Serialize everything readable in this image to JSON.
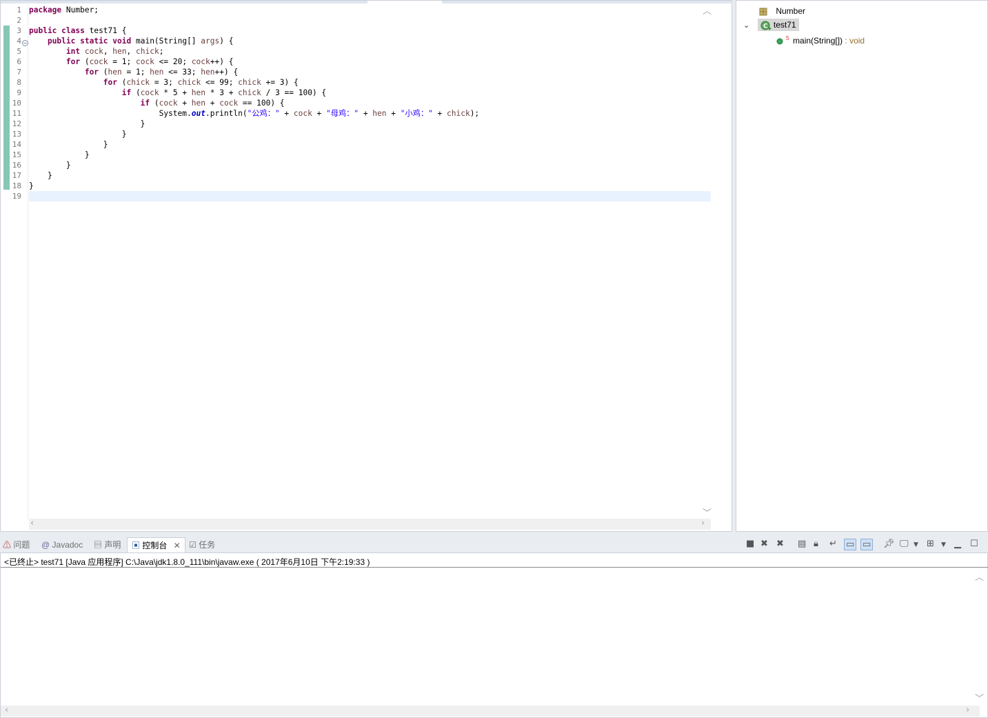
{
  "editor": {
    "lines": [
      {
        "num": "1",
        "html_parts": [
          [
            "kw",
            "package"
          ],
          [
            "p",
            " Number;"
          ]
        ]
      },
      {
        "num": "2",
        "html_parts": []
      },
      {
        "num": "3",
        "html_parts": [
          [
            "kw",
            "public"
          ],
          [
            "p",
            " "
          ],
          [
            "kw",
            "class"
          ],
          [
            "p",
            " test71 {"
          ]
        ]
      },
      {
        "num": "4",
        "html_parts": [
          [
            "p",
            "    "
          ],
          [
            "kw",
            "public"
          ],
          [
            "p",
            " "
          ],
          [
            "kw",
            "static"
          ],
          [
            "p",
            " "
          ],
          [
            "kw",
            "void"
          ],
          [
            "p",
            " main(String[] "
          ],
          [
            "var",
            "args"
          ],
          [
            "p",
            ") {"
          ]
        ]
      },
      {
        "num": "5",
        "html_parts": [
          [
            "p",
            "        "
          ],
          [
            "kw",
            "int"
          ],
          [
            "p",
            " "
          ],
          [
            "var",
            "cock"
          ],
          [
            "p",
            ", "
          ],
          [
            "var",
            "hen"
          ],
          [
            "p",
            ", "
          ],
          [
            "var",
            "chick"
          ],
          [
            "p",
            ";"
          ]
        ]
      },
      {
        "num": "6",
        "html_parts": [
          [
            "p",
            "        "
          ],
          [
            "kw",
            "for"
          ],
          [
            "p",
            " ("
          ],
          [
            "var",
            "cock"
          ],
          [
            "p",
            " = 1; "
          ],
          [
            "var",
            "cock"
          ],
          [
            "p",
            " <= 20; "
          ],
          [
            "var",
            "cock"
          ],
          [
            "p",
            "++) {"
          ]
        ]
      },
      {
        "num": "7",
        "html_parts": [
          [
            "p",
            "            "
          ],
          [
            "kw",
            "for"
          ],
          [
            "p",
            " ("
          ],
          [
            "var",
            "hen"
          ],
          [
            "p",
            " = 1; "
          ],
          [
            "var",
            "hen"
          ],
          [
            "p",
            " <= 33; "
          ],
          [
            "var",
            "hen"
          ],
          [
            "p",
            "++) {"
          ]
        ]
      },
      {
        "num": "8",
        "html_parts": [
          [
            "p",
            "                "
          ],
          [
            "kw",
            "for"
          ],
          [
            "p",
            " ("
          ],
          [
            "var",
            "chick"
          ],
          [
            "p",
            " = 3; "
          ],
          [
            "var",
            "chick"
          ],
          [
            "p",
            " <= 99; "
          ],
          [
            "var",
            "chick"
          ],
          [
            "p",
            " += 3) {"
          ]
        ]
      },
      {
        "num": "9",
        "html_parts": [
          [
            "p",
            "                    "
          ],
          [
            "kw",
            "if"
          ],
          [
            "p",
            " ("
          ],
          [
            "var",
            "cock"
          ],
          [
            "p",
            " * 5 + "
          ],
          [
            "var",
            "hen"
          ],
          [
            "p",
            " * 3 + "
          ],
          [
            "var",
            "chick"
          ],
          [
            "p",
            " / 3 == 100) {"
          ]
        ]
      },
      {
        "num": "10",
        "html_parts": [
          [
            "p",
            "                        "
          ],
          [
            "kw",
            "if"
          ],
          [
            "p",
            " ("
          ],
          [
            "var",
            "cock"
          ],
          [
            "p",
            " + "
          ],
          [
            "var",
            "hen"
          ],
          [
            "p",
            " + "
          ],
          [
            "var",
            "cock"
          ],
          [
            "p",
            " == 100) {"
          ]
        ]
      },
      {
        "num": "11",
        "html_parts": [
          [
            "p",
            "                            System."
          ],
          [
            "fld",
            "out"
          ],
          [
            "p",
            ".println("
          ],
          [
            "str",
            "\"公鸡：\""
          ],
          [
            "p",
            " + "
          ],
          [
            "var",
            "cock"
          ],
          [
            "p",
            " + "
          ],
          [
            "str",
            "\"母鸡：\""
          ],
          [
            "p",
            " + "
          ],
          [
            "var",
            "hen"
          ],
          [
            "p",
            " + "
          ],
          [
            "str",
            "\"小鸡：\""
          ],
          [
            "p",
            " + "
          ],
          [
            "var",
            "chick"
          ],
          [
            "p",
            ");"
          ]
        ]
      },
      {
        "num": "12",
        "html_parts": [
          [
            "p",
            "                        }"
          ]
        ]
      },
      {
        "num": "13",
        "html_parts": [
          [
            "p",
            "                    }"
          ]
        ]
      },
      {
        "num": "14",
        "html_parts": [
          [
            "p",
            "                }"
          ]
        ]
      },
      {
        "num": "15",
        "html_parts": [
          [
            "p",
            "            }"
          ]
        ]
      },
      {
        "num": "16",
        "html_parts": [
          [
            "p",
            "        }"
          ]
        ]
      },
      {
        "num": "17",
        "html_parts": [
          [
            "p",
            "    }"
          ]
        ]
      },
      {
        "num": "18",
        "html_parts": [
          [
            "p",
            "}"
          ]
        ]
      },
      {
        "num": "19",
        "html_parts": []
      }
    ]
  },
  "outline": {
    "package": "Number",
    "class": "test71",
    "static_marker": "S",
    "method": "main(String[])",
    "method_return": " : void"
  },
  "bottom_tabs": {
    "problems": "问题",
    "javadoc": "Javadoc",
    "declaration": "声明",
    "console": "控制台",
    "tasks": "任务"
  },
  "console": {
    "description": "<已终止> test71 [Java 应用程序] C:\\Java\\jdk1.8.0_111\\bin\\javaw.exe ( 2017年6月10日 下午2:19:33 )"
  },
  "colors": {
    "keyword": "#7f0055",
    "string": "#2a00ff",
    "field": "#0000c0",
    "variable": "#6a3e3e",
    "change_ruler": "#86c7b1",
    "cursor_line": "#e8f2fe"
  }
}
